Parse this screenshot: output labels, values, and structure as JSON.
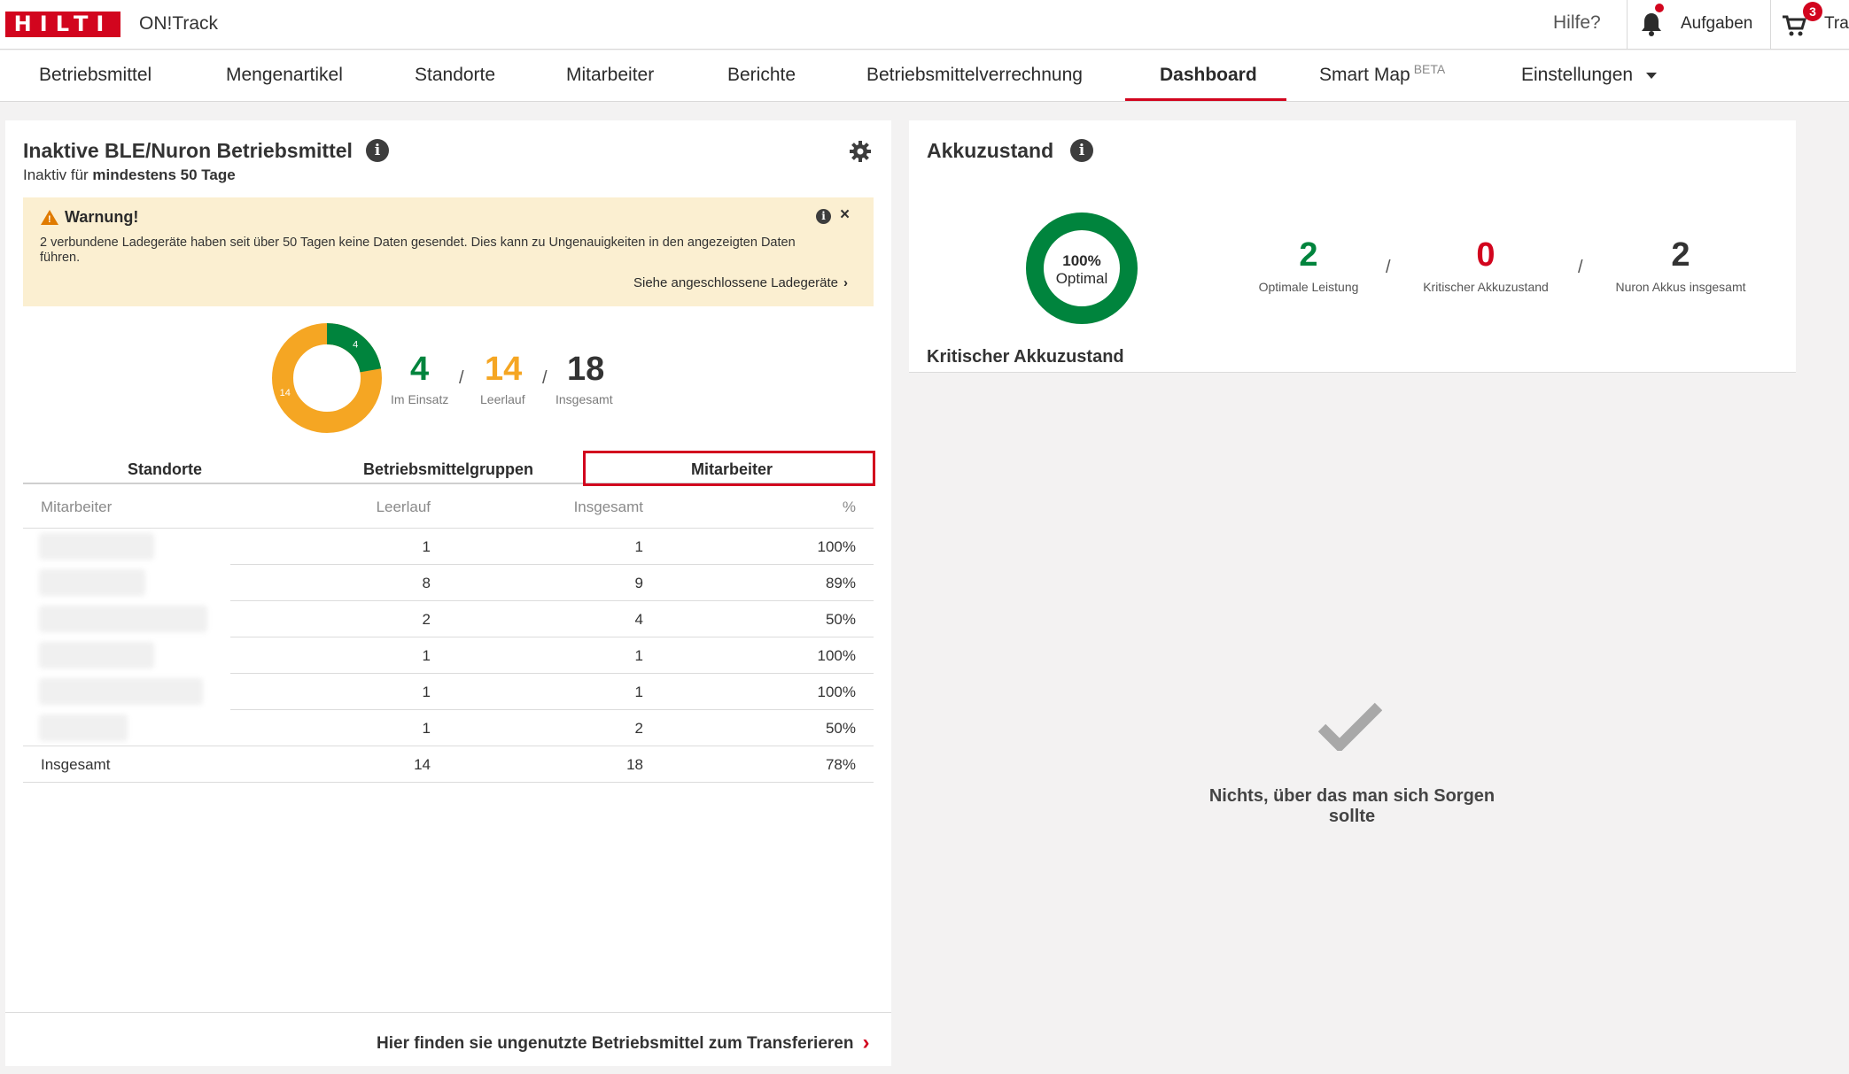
{
  "topbar": {
    "logo_text": "HILTI",
    "app_name": "ON!Track",
    "hilfe": "Hilfe?",
    "aufgaben": "Aufgaben",
    "cart_badge": "3",
    "truncated_label": "Tra"
  },
  "nav": {
    "items": [
      {
        "label": "Betriebsmittel"
      },
      {
        "label": "Mengenartikel"
      },
      {
        "label": "Standorte"
      },
      {
        "label": "Mitarbeiter"
      },
      {
        "label": "Berichte"
      },
      {
        "label": "Betriebsmittelverrechnung"
      },
      {
        "label": "Dashboard",
        "active": true
      },
      {
        "label": "Smart Map",
        "badge": "BETA"
      },
      {
        "label": "Einstellungen"
      }
    ]
  },
  "inactive": {
    "title": "Inaktive BLE/Nuron Betriebsmittel",
    "subtitle_prefix": "Inaktiv für ",
    "subtitle_bold": "mindestens 50 Tage",
    "warning": {
      "title": "Warnung!",
      "text": "2 verbundene Ladegeräte haben seit über 50 Tagen keine Daten gesendet. Dies kann zu Ungenauigkeiten in den angezeigten Daten führen.",
      "link": "Siehe angeschlossene Ladegeräte"
    },
    "donut": {
      "in_use": 4,
      "idle": 14,
      "total": 18,
      "label_in_use": "4",
      "label_idle": "14"
    },
    "stats": [
      {
        "value": "4",
        "label": "Im Einsatz",
        "color": "#00843d"
      },
      {
        "value": "14",
        "label": "Leerlauf",
        "color": "#f5a623"
      },
      {
        "value": "18",
        "label": "Insgesamt",
        "color": "#333333"
      }
    ],
    "tabs": [
      "Standorte",
      "Betriebsmittelgruppen",
      "Mitarbeiter"
    ],
    "table": {
      "headers": [
        "Mitarbeiter",
        "Leerlauf",
        "Insgesamt",
        "%"
      ],
      "rows": [
        {
          "leerlauf": "1",
          "insgesamt": "1",
          "pct": "100%"
        },
        {
          "leerlauf": "8",
          "insgesamt": "9",
          "pct": "89%"
        },
        {
          "leerlauf": "2",
          "insgesamt": "4",
          "pct": "50%"
        },
        {
          "leerlauf": "1",
          "insgesamt": "1",
          "pct": "100%"
        },
        {
          "leerlauf": "1",
          "insgesamt": "1",
          "pct": "100%"
        },
        {
          "leerlauf": "1",
          "insgesamt": "2",
          "pct": "50%"
        }
      ],
      "total": {
        "label": "Insgesamt",
        "leerlauf": "14",
        "insgesamt": "18",
        "pct": "78%"
      }
    },
    "footer_link": "Hier finden sie ungenutzte Betriebsmittel zum Transferieren"
  },
  "battery": {
    "title": "Akkuzustand",
    "donut_pct": "100%",
    "donut_label": "Optimal",
    "stats": [
      {
        "value": "2",
        "label": "Optimale Leistung",
        "color": "#00843d"
      },
      {
        "value": "0",
        "label": "Kritischer Akkuzustand",
        "color": "#d2051e"
      },
      {
        "value": "2",
        "label": "Nuron Akkus insgesamt",
        "color": "#333333"
      }
    ],
    "critical_title": "Kritischer Akkuzustand",
    "empty_message": "Nichts, über das man sich Sorgen sollte"
  },
  "colors": {
    "brand": "#d2051e",
    "green": "#00843d",
    "yellow": "#f5a623"
  }
}
